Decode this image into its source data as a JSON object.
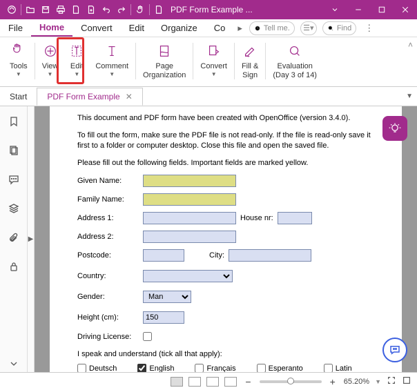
{
  "title_bar": {
    "title": "PDF Form Example ..."
  },
  "menu": {
    "items": [
      "File",
      "Home",
      "Convert",
      "Edit",
      "Organize",
      "Co"
    ],
    "active_index": 1,
    "tellme_placeholder": "Tell me.",
    "find_placeholder": "Find"
  },
  "ribbon": {
    "groups": [
      {
        "label": "Tools",
        "drop": true
      },
      {
        "label": "View",
        "drop": true
      },
      {
        "label": "Edit",
        "drop": true
      },
      {
        "label": "Comment",
        "drop": true
      },
      {
        "label": "Page\nOrganization",
        "drop": true
      },
      {
        "label": "Convert",
        "drop": true
      },
      {
        "label": "Fill &\nSign",
        "drop": false
      },
      {
        "label": "Evaluation\n(Day 3 of 14)",
        "drop": true
      }
    ]
  },
  "tabs": {
    "start": "Start",
    "active": "PDF Form Example"
  },
  "doc": {
    "p1": "This document and PDF form have been created with OpenOffice (version 3.4.0).",
    "p2": "To fill out the form, make sure the PDF file is not read-only. If the file is read-only save it first to a folder or computer desktop. Close this file and open the saved file.",
    "p3": "Please fill out the following fields. Important fields are marked yellow.",
    "labels": {
      "given_name": "Given Name:",
      "family_name": "Family Name:",
      "address1": "Address 1:",
      "house_nr": "House nr:",
      "address2": "Address 2:",
      "postcode": "Postcode:",
      "city": "City:",
      "country": "Country:",
      "gender": "Gender:",
      "height": "Height (cm):",
      "driving": "Driving License:",
      "lang_intro": "I speak and understand (tick all that apply):"
    },
    "values": {
      "gender": "Man",
      "height": "150"
    },
    "langs": [
      "Deutsch",
      "English",
      "Français",
      "Esperanto",
      "Latin"
    ],
    "langs_checked": [
      false,
      true,
      false,
      false,
      false
    ]
  },
  "status": {
    "zoom": "65.20%"
  }
}
